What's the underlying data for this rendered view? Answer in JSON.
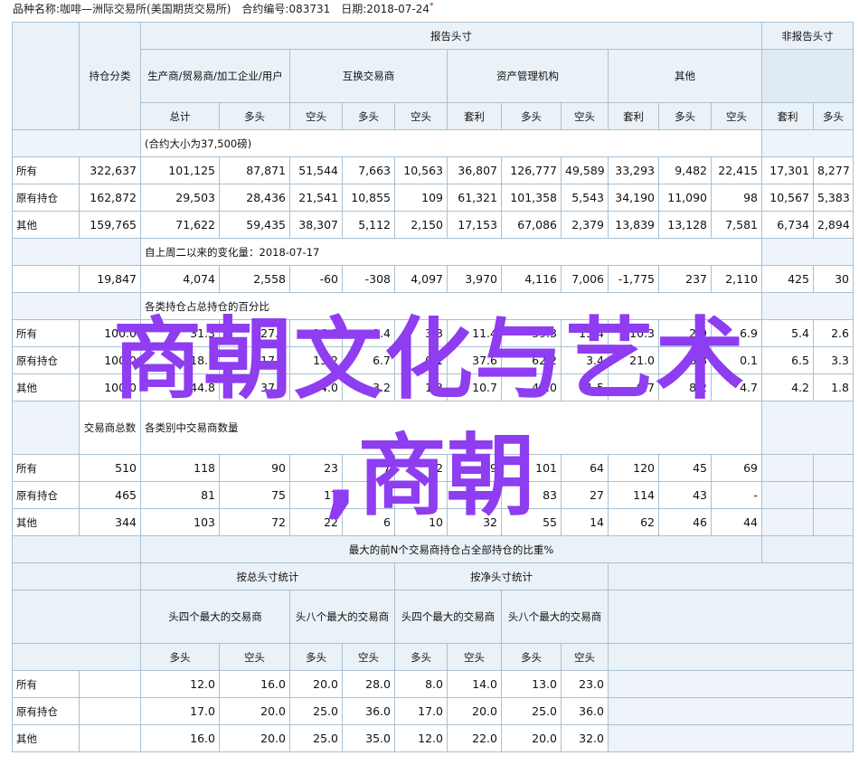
{
  "header": {
    "text": "品种名称:咖啡—洲际交易所(美国期货交易所)　合约编号:083731　日期:2018-07-24",
    "mark": "*"
  },
  "labels": {
    "report_header": "报告头寸",
    "non_report": "非报告头寸",
    "pos_class": "持仓分类",
    "producer": "生产商/贸易商/加工企业/用户",
    "swap": "互换交易商",
    "money": "资产管理机构",
    "other": "其他",
    "total": "总计",
    "long": "多头",
    "short": "空头",
    "spread": "套利",
    "all": "所有",
    "old": "原有持仓",
    "oth": "其他",
    "trader_total": "交易商总数",
    "cat_traders": "各类别中交易商数量",
    "top_ratio": "最大的前N个交易商持仓占全部持仓的比重%",
    "by_gross": "按总头寸统计",
    "by_net": "按净头寸统计",
    "top4": "头四个最大的交易商",
    "top8": "头八个最大的交易商"
  },
  "sections": {
    "positions": {
      "caption": "(合约大小为37,500磅)",
      "rows": [
        {
          "label": "所有",
          "values": [
            "322,637",
            "101,125",
            "87,871",
            "51,544",
            "7,663",
            "10,563",
            "36,807",
            "126,777",
            "49,589",
            "33,293",
            "9,482",
            "22,415",
            "17,301",
            "8,277"
          ]
        },
        {
          "label": "原有持仓",
          "values": [
            "162,872",
            "29,503",
            "28,436",
            "21,541",
            "10,855",
            "109",
            "61,321",
            "101,358",
            "5,543",
            "34,190",
            "11,090",
            "98",
            "10,567",
            "5,383"
          ]
        },
        {
          "label": "其他",
          "values": [
            "159,765",
            "71,622",
            "59,435",
            "38,307",
            "5,112",
            "2,150",
            "17,153",
            "67,086",
            "2,379",
            "13,839",
            "13,128",
            "7,581",
            "6,734",
            "2,894"
          ]
        }
      ]
    },
    "changes": {
      "caption": "自上周二以来的变化量：2018-07-17",
      "values": [
        "19,847",
        "4,074",
        "2,558",
        "-60",
        "-308",
        "4,097",
        "3,970",
        "4,116",
        "7,006",
        "-1,775",
        "237",
        "2,110",
        "425",
        "30"
      ]
    },
    "percent": {
      "caption": "各类持仓占总持仓的百分比",
      "rows": [
        {
          "label": "所有",
          "values": [
            "100.0",
            "31.3",
            "27.2",
            "16.0",
            "2.4",
            "3.3",
            "11.4",
            "39.3",
            "15.4",
            "10.3",
            "2.9",
            "6.9",
            "5.4",
            "2.6"
          ]
        },
        {
          "label": "原有持仓",
          "values": [
            "100.0",
            "18.1",
            "17.5",
            "13.2",
            "6.7",
            "0.1",
            "37.6",
            "62.2",
            "3.4",
            "21.0",
            "6.8",
            "0.1",
            "6.5",
            "3.3"
          ]
        },
        {
          "label": "其他",
          "values": [
            "100.0",
            "44.8",
            "37.2",
            "24.0",
            "3.2",
            "1.3",
            "10.7",
            "42.0",
            "1.5",
            "8.7",
            "8.2",
            "4.7",
            "4.2",
            "1.8"
          ]
        }
      ]
    },
    "traders": {
      "rows": [
        {
          "label": "所有",
          "values": [
            "510",
            "118",
            "90",
            "23",
            "7",
            "12",
            "29",
            "101",
            "64",
            "120",
            "45",
            "69",
            "",
            ""
          ]
        },
        {
          "label": "原有持仓",
          "values": [
            "465",
            "81",
            "75",
            "17",
            "9",
            "",
            "6",
            "83",
            "27",
            "114",
            "43",
            "-",
            "",
            ""
          ]
        },
        {
          "label": "其他",
          "values": [
            "344",
            "103",
            "72",
            "22",
            "6",
            "10",
            "32",
            "55",
            "14",
            "62",
            "46",
            "44",
            "",
            ""
          ]
        }
      ]
    },
    "concentration": {
      "rows": [
        {
          "label": "所有",
          "values": [
            "12.0",
            "16.0",
            "20.0",
            "28.0",
            "8.0",
            "14.0",
            "13.0",
            "23.0"
          ]
        },
        {
          "label": "原有持仓",
          "values": [
            "17.0",
            "20.0",
            "25.0",
            "36.0",
            "17.0",
            "20.0",
            "25.0",
            "36.0"
          ]
        },
        {
          "label": "其他",
          "values": [
            "16.0",
            "20.0",
            "25.0",
            "35.0",
            "12.0",
            "22.0",
            "20.0",
            "32.0"
          ]
        }
      ]
    }
  },
  "watermark": {
    "line1": "商朝文化与艺术",
    "line2": ",商朝"
  }
}
